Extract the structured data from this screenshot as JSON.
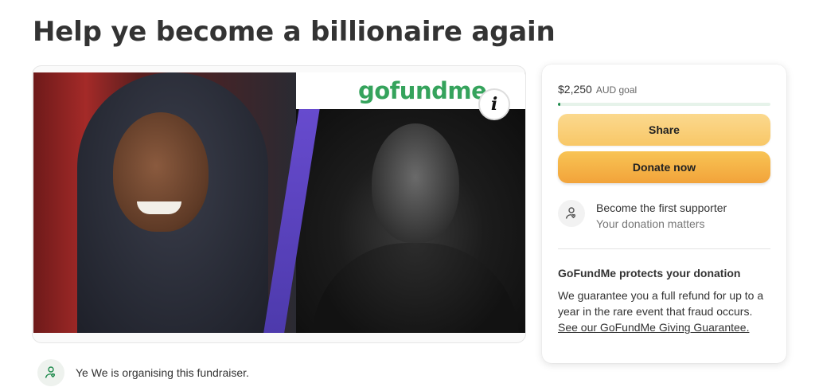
{
  "page": {
    "title": "Help ye become a billionaire again"
  },
  "media": {
    "logo_text": "gofundme",
    "info_glyph": "i"
  },
  "organiser": {
    "text": "Ye We is organising this fundraiser.",
    "icon": "person-heart-icon"
  },
  "donation_panel": {
    "goal_amount": "$2,250",
    "goal_label": "AUD goal",
    "progress_fraction": 0.01,
    "share_label": "Share",
    "donate_label": "Donate now",
    "supporter_title": "Become the first supporter",
    "supporter_sub": "Your donation matters",
    "protect_title": "GoFundMe protects your donation",
    "protect_body": "We guarantee you a full refund for up to a year in the rare event that fraud occurs.",
    "protect_link": "See our GoFundMe Giving Guarantee."
  },
  "colors": {
    "accent_green": "#1e8a4c",
    "share_button": "#f8c767",
    "donate_button": "#f2a33a",
    "logo_green": "#35a35c"
  }
}
